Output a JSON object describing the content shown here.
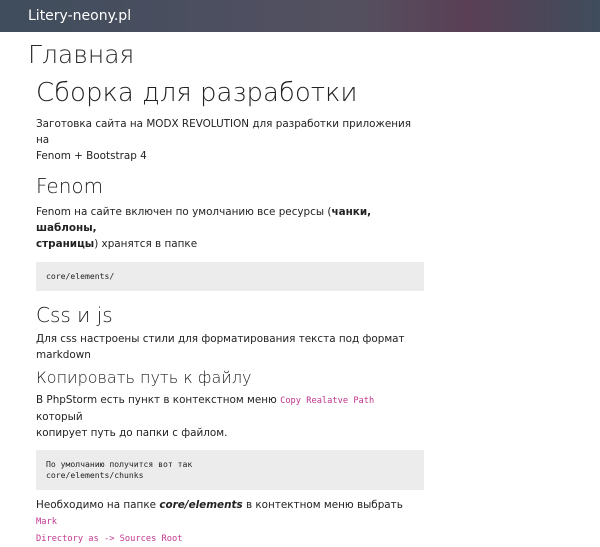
{
  "navbar": {
    "brand": "Litery-neony.pl"
  },
  "page": {
    "title": "Главная"
  },
  "article": {
    "heading": "Сборка для разработки",
    "intro_line1": "Заготовка сайта на MODX REVOLUTION для разработки приложения на",
    "intro_line2": "Fenom + Bootstrap 4",
    "fenom": {
      "heading": "Fenom",
      "text_prefix": "Fenom на сайте включен по умолчанию все ресурсы (",
      "text_bold_1": "чанки, шаблоны,",
      "text_bold_2": "страницы",
      "text_suffix": ") хранятся в папке",
      "code": "core/elements/"
    },
    "css": {
      "heading": "Css и js",
      "text": "Для css настроены стили для форматирования текста под формат markdown"
    },
    "copy_path": {
      "heading": "Копировать путь к файлу",
      "text_prefix": "В PhpStorm есть пункт в контекстном меню",
      "inline_code": "Copy Realatve Path",
      "text_suffix": "который",
      "text_line2": "копирует путь до папки с файлом.",
      "code_line1": "По умолчанию получится вот так",
      "code_line2": "core/elements/chunks"
    },
    "mark": {
      "text_prefix": "Необходимо на папке",
      "bold_italic": "core/elements",
      "text_middle": "в контектном меню выбрать",
      "inline_code_1": "Mark",
      "inline_code_2": "Directory as -> Sources Root"
    }
  }
}
